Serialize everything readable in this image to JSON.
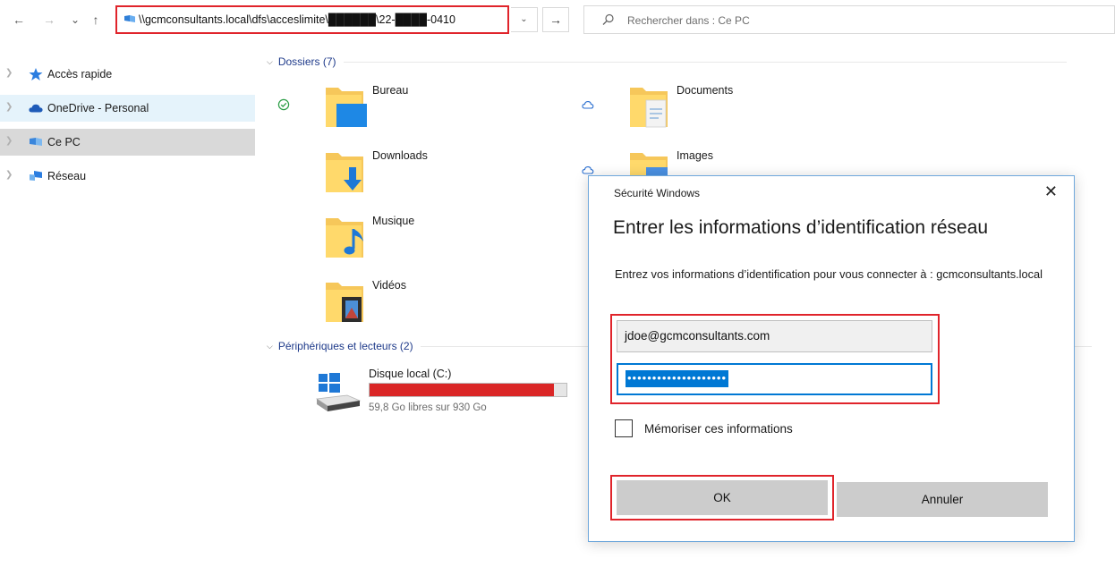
{
  "toolbar": {
    "back_glyph": "←",
    "forward_glyph": "→",
    "recent_glyph": "⌄",
    "up_glyph": "↑",
    "address": "\\\\gcmconsultants.local\\dfs\\acceslimite\\██████\\22-████-0410",
    "dropdown_glyph": "⌄",
    "go_glyph": "→",
    "search_placeholder": "Rechercher dans : Ce PC"
  },
  "nav": {
    "items": [
      {
        "label": "Accès rapide",
        "icon": "star-icon"
      },
      {
        "label": "OneDrive - Personal",
        "icon": "cloud-icon"
      },
      {
        "label": "Ce PC",
        "icon": "computer-icon"
      },
      {
        "label": "Réseau",
        "icon": "network-icon"
      }
    ]
  },
  "content": {
    "folders_header": "Dossiers (7)",
    "folders": [
      {
        "name": "Bureau",
        "icon": "desktop-folder-icon",
        "status": "synced-check-icon"
      },
      {
        "name": "Documents",
        "icon": "documents-folder-icon",
        "status": "cloud-outline-icon"
      },
      {
        "name": "Downloads",
        "icon": "downloads-folder-icon"
      },
      {
        "name": "Images",
        "icon": "pictures-folder-icon",
        "status": "cloud-outline-icon"
      },
      {
        "name": "Musique",
        "icon": "music-folder-icon"
      },
      {
        "name": "Vidéos",
        "icon": "videos-folder-icon"
      }
    ],
    "devices_header": "Périphériques et lecteurs (2)",
    "drive": {
      "name": "Disque local (C:)",
      "free_text": "59,8 Go libres sur 930 Go",
      "used_fraction": 0.936
    }
  },
  "dialog": {
    "caption": "Sécurité Windows",
    "close_glyph": "✕",
    "title": "Entrer les informations d’identification réseau",
    "description": "Entrez vos informations d’identification pour vous connecter à : gcmconsultants.local",
    "username": "jdoe@gcmconsultants.com",
    "password_mask": "••••••••••••••••••••",
    "remember_label": "Mémoriser ces informations",
    "ok_label": "OK",
    "cancel_label": "Annuler"
  },
  "colors": {
    "highlight_red": "#e0242b",
    "accent_blue": "#0078d4",
    "drive_bar_red": "#da2626",
    "hover_bg": "#e5f3fb",
    "selected_bg": "#d9d9d9"
  }
}
